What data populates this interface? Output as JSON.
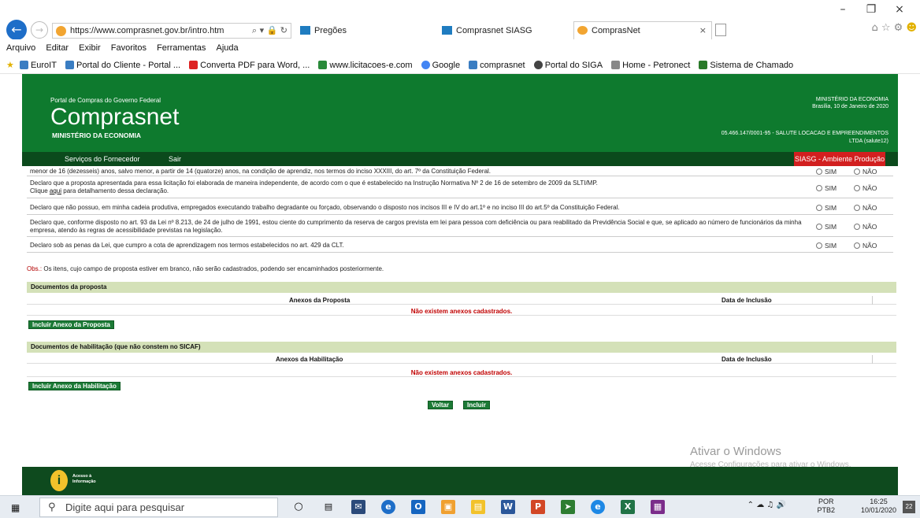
{
  "browser": {
    "url": "https://www.comprasnet.gov.br/intro.htm",
    "tabs": [
      {
        "label": "Pregões"
      },
      {
        "label": "Comprasnet SIASG"
      },
      {
        "label": "ComprasNet"
      }
    ],
    "menu": [
      "Arquivo",
      "Editar",
      "Exibir",
      "Favoritos",
      "Ferramentas",
      "Ajuda"
    ],
    "favorites": [
      "EuroIT",
      "Portal do Cliente - Portal ...",
      "Converta PDF para Word, ...",
      "www.licitacoes-e.com",
      "Google",
      "comprasnet",
      "Portal do SIGA",
      "Home - Petronect",
      "Sistema de Chamado"
    ]
  },
  "header": {
    "portal": "Portal de Compras do Governo Federal",
    "logo": "Comprasnet",
    "ministry": "MINISTÉRIO DA ECONOMIA",
    "right_ministry": "MINISTÉRIO DA ECONOMIA",
    "right_date": "Brasília, 10 de Janeiro de 2020",
    "company": "05.466.147/0001-95 - SALUTE LOCACAO E EMPREENDIMENTOS",
    "company_user": "LTDA (salute12)"
  },
  "nav": {
    "items": [
      "Serviços do Fornecedor",
      "Sair"
    ],
    "env": "SIASG - Ambiente Produção"
  },
  "declarations": [
    {
      "text": "menor de 16 (dezesseis) anos, salvo menor, a partir de 14 (quatorze) anos, na condição de aprendiz, nos termos do inciso XXXIII, do art. 7º da Constituição Federal."
    },
    {
      "text": "Declaro que a proposta apresentada para essa licitação foi elaborada de maneira independente, de acordo com o que é estabelecido na Instrução Normativa Nº 2 de 16 de setembro de 2009 da SLTI/MP.",
      "line2_pre": "Clique ",
      "link": "aqui",
      "line2_post": " para detalhamento dessa declaração."
    },
    {
      "text": "Declaro que não possuo, em minha cadeia produtiva, empregados executando trabalho degradante ou forçado, observando o disposto nos incisos III e IV do art.1º e no inciso III do art.5º da Constituição Federal."
    },
    {
      "text": "Declaro que, conforme disposto no art. 93 da Lei nº 8.213, de 24 de julho de 1991, estou ciente do cumprimento da reserva de cargos prevista em lei para pessoa com deficiência ou para reabilitado da Previdência Social e que, se aplicado ao número de funcionários da minha empresa, atendo às regras de acessibilidade previstas na legislação."
    },
    {
      "text": "Declaro sob as penas da Lei, que cumpro a cota de aprendizagem nos termos estabelecidos no art. 429 da CLT."
    }
  ],
  "options": {
    "sim": "SIM",
    "nao": "NÃO"
  },
  "obs": {
    "label": "Obs.:",
    "text": " Os itens, cujo campo de proposta estiver em branco, não serão cadastrados, podendo ser encaminhados posteriormente."
  },
  "proposta": {
    "title": "Documentos da proposta",
    "col1": "Anexos da Proposta",
    "col2": "Data de Inclusão",
    "empty": "Não existem anexos cadastrados.",
    "button": "Incluir Anexo da Proposta"
  },
  "habilitacao": {
    "title": "Documentos de habilitação (que não constem no SICAF)",
    "col1": "Anexos da Habilitação",
    "col2": "Data de Inclusão",
    "empty": "Não existem anexos cadastrados.",
    "button": "Incluir Anexo da Habilitação"
  },
  "actions": {
    "voltar": "Voltar",
    "incluir": "Incluir"
  },
  "watermark": {
    "line1": "Ativar o Windows",
    "line2": "Acesse Configurações para ativar o Windows."
  },
  "footer": {
    "access_line1": "Acesso à",
    "access_line2": "Informação"
  },
  "taskbar": {
    "search_placeholder": "Digite aqui para pesquisar",
    "lang1": "POR",
    "lang2": "PTB2",
    "time": "16:25",
    "date": "10/01/2020",
    "notifications": "22"
  }
}
